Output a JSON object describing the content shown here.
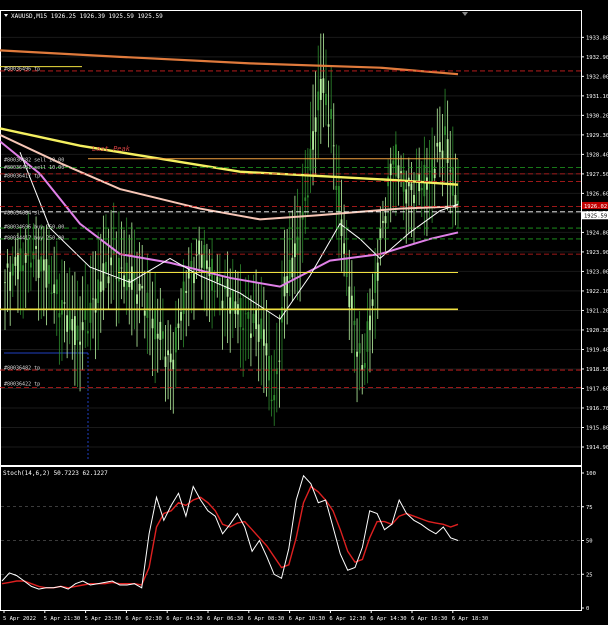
{
  "window": {
    "symbol_title": "XAUUSD,M15",
    "ohlc": "1926.25 1926.39 1925.59 1925.59"
  },
  "colors": {
    "background": "#000000",
    "bull_candle": "#b6f2a0",
    "bear_candle": "#2e8b2e",
    "axis": "#ffffff",
    "grid": "#1a1a1a",
    "ma_orange": "#e07a3c",
    "ma_yellow": "#f5f060",
    "ma_peach": "#f7c6b6",
    "ma_pink": "#e080e8",
    "ma_white": "#ffffff",
    "level_yellow": "#f0e040",
    "level_orange": "#f0a040",
    "sell_red": "#d02020",
    "buy_green": "#20a020",
    "stoch_main": "#ffffff",
    "stoch_signal": "#dd2020",
    "price_tag_bg": "#c00000"
  },
  "price_axis": {
    "min": 1914.3,
    "max": 1934.6,
    "labels": [
      "1933.80",
      "1932.90",
      "1932.00",
      "1931.10",
      "1930.20",
      "1929.30",
      "1928.40",
      "1927.50",
      "1926.60",
      "1925.70",
      "1924.80",
      "1923.90",
      "1923.00",
      "1922.10",
      "1921.20",
      "1920.30",
      "1919.40",
      "1918.50",
      "1917.60",
      "1916.70",
      "1915.80",
      "1914.90"
    ],
    "current_price": "1925.59",
    "red_tag": "1926.02"
  },
  "time_axis": {
    "labels": [
      "5 Apr 2022",
      "5 Apr 21:30",
      "5 Apr 23:30",
      "6 Apr 02:30",
      "6 Apr 04:30",
      "6 Apr 06:30",
      "6 Apr 08:30",
      "6 Apr 10:30",
      "6 Apr 12:30",
      "6 Apr 14:30",
      "6 Apr 16:30",
      "6 Apr 18:30"
    ]
  },
  "orders": [
    {
      "label": "#80036496 tp",
      "price": 1932.35
    },
    {
      "label": "#80036482 sell 10.00",
      "price": 1928.15
    },
    {
      "label": "#80036481 sell 10.00",
      "price": 1927.8
    },
    {
      "label": "#80036417 tp",
      "price": 1927.4
    },
    {
      "label": "#80034684 sl",
      "price": 1925.7
    },
    {
      "label": "#80034696 buy 250.00",
      "price": 1925.05
    },
    {
      "label": "#80034417 buy 250.00",
      "price": 1924.55
    },
    {
      "label": "#80036482 tp",
      "price": 1918.55
    },
    {
      "label": "#80036422 tp",
      "price": 1917.8
    }
  ],
  "annotation": {
    "text": "Last Peak"
  },
  "stochastic": {
    "title": "Stoch(14,6,2) 50.7223 62.1227",
    "levels": [
      "100",
      "75",
      "50",
      "25",
      "0"
    ],
    "main": [
      20,
      26,
      24,
      20,
      16,
      14,
      15,
      15,
      16,
      14,
      18,
      20,
      17,
      18,
      19,
      20,
      17,
      17,
      18,
      15,
      55,
      82,
      65,
      76,
      85,
      68,
      90,
      80,
      72,
      68,
      55,
      62,
      70,
      60,
      42,
      50,
      38,
      25,
      22,
      44,
      80,
      98,
      92,
      78,
      80,
      60,
      40,
      28,
      30,
      45,
      72,
      70,
      58,
      62,
      80,
      70,
      65,
      62,
      58,
      55,
      60,
      52,
      50
    ],
    "signal": [
      18,
      19,
      20,
      20,
      18,
      16,
      15,
      15,
      16,
      15,
      16,
      17,
      18,
      18,
      18,
      19,
      18,
      18,
      18,
      17,
      30,
      60,
      70,
      72,
      78,
      76,
      80,
      82,
      78,
      72,
      62,
      60,
      63,
      64,
      58,
      52,
      46,
      38,
      30,
      32,
      52,
      78,
      90,
      86,
      80,
      72,
      58,
      42,
      34,
      36,
      52,
      64,
      64,
      62,
      68,
      70,
      68,
      66,
      64,
      63,
      62,
      60,
      62
    ]
  }
}
